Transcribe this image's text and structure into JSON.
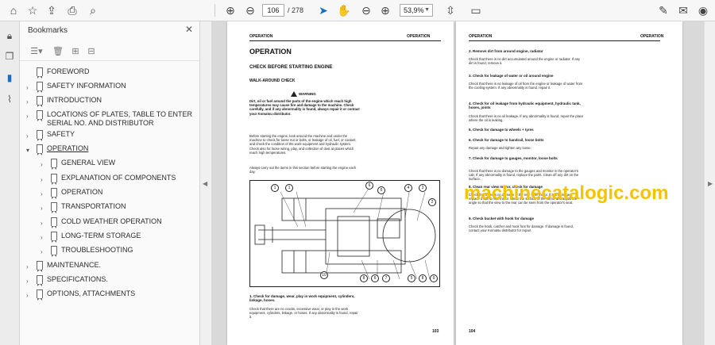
{
  "toolbar": {
    "page_current": "106",
    "page_total": "/ 278",
    "zoom": "53,9%",
    "icons": [
      "home-icon",
      "star-icon",
      "upload-icon",
      "print-icon",
      "zoom-search-icon",
      "prev-page-icon",
      "next-page-icon",
      "cursor-icon",
      "hand-icon",
      "zoom-out-icon",
      "zoom-in-icon",
      "fit-page-icon",
      "comment-icon",
      "pen-sign-icon",
      "mail-icon",
      "account-icon"
    ]
  },
  "bookmarks": {
    "title": "Bookmarks",
    "items": [
      {
        "label": "FOREWORD",
        "level": 0,
        "expandable": false
      },
      {
        "label": "SAFETY INFORMATION",
        "level": 0,
        "expandable": true
      },
      {
        "label": "INTRODUCTION",
        "level": 0,
        "expandable": true
      },
      {
        "label": "LOCATIONS OF PLATES, TABLE TO ENTER SERIAL NO. AND DISTRIBUTOR",
        "level": 0,
        "expandable": true
      },
      {
        "label": "SAFETY",
        "level": 0,
        "expandable": true
      },
      {
        "label": "OPERATION",
        "level": 0,
        "expandable": true,
        "expanded": true,
        "selected": true
      },
      {
        "label": "GENERAL VIEW",
        "level": 1,
        "expandable": true
      },
      {
        "label": "EXPLANATION OF COMPONENTS",
        "level": 1,
        "expandable": true
      },
      {
        "label": "OPERATION",
        "level": 1,
        "expandable": true
      },
      {
        "label": "TRANSPORTATION",
        "level": 1,
        "expandable": true
      },
      {
        "label": "COLD WEATHER OPERATION",
        "level": 1,
        "expandable": true
      },
      {
        "label": "LONG-TERM STORAGE",
        "level": 1,
        "expandable": true
      },
      {
        "label": "TROUBLESHOOTING",
        "level": 1,
        "expandable": true
      },
      {
        "label": "MAINTENANCE.",
        "level": 0,
        "expandable": true
      },
      {
        "label": "SPECIFICATIONS.",
        "level": 0,
        "expandable": true
      },
      {
        "label": "OPTIONS, ATTACHMENTS",
        "level": 0,
        "expandable": true
      }
    ]
  },
  "left_page": {
    "header_left": "OPERATION",
    "header_right": "OPERATION",
    "section": "OPERATION",
    "subsection": "CHECK BEFORE STARTING ENGINE",
    "subsub": "WALK-AROUND CHECK",
    "warning_label": "WARNING",
    "warning_text": "Dirt, oil or fuel around the parts of the engine which reach high temperatures may cause fire and damage to the machine. Check carefully, and if any abnormality is found, always repair it or contact your Komatsu distributor.",
    "body1": "Before starting the engine, look around the machine and under the machine to check for loose nut or bolts, or leakage of oil, fuel, or coolant, and check the condition of the work equipment and hydraulic system. Check also for loose wiring, play, and collection of dust at places which reach high temperatures.",
    "body2": "Always carry out the items in this section before starting the engine each day.",
    "callouts": [
      "1",
      "1",
      "6",
      "6",
      "4",
      "3",
      "2",
      "10",
      "8",
      "6",
      "7",
      "5",
      "8",
      "9"
    ],
    "item1_title": "1. Check for damage, wear, play in work equipment, cylinders, linkage, hoses.",
    "item1_text": "Check that there are no cracks, excessive wear, or play in the work equipment, cylinders, linkage, or hoses. If any abnormality is found, repair it.",
    "page_number": "103"
  },
  "right_page": {
    "header_left": "OPERATION",
    "header_right": "OPERATION",
    "items": [
      {
        "title": "2. Remove dirt from around engine, radiator",
        "text": "Check that there is no dirt accumulated around the engine or radiator. If any dirt is found, remove it."
      },
      {
        "title": "3. Check for leakage of water or oil around engine",
        "text": "Check that there is no leakage of oil from the engine or leakage of water from the cooling system. If any abnormality is found, repair it."
      },
      {
        "title": "4. Check for oil leakage from hydraulic equipment, hydraulic tank, hoses, joints",
        "text": "Check that there is no oil leakage. If any abnormality is found, repair the place where the oil is leaking."
      },
      {
        "title": "5. Check for damage to wheels + tyres",
        "text": ""
      },
      {
        "title": "6. Check for damage to handrail, loose bolts",
        "text": "Repair any damage and tighten any loose."
      },
      {
        "title": "7. Check for damage to gauges, monitor, loose bolts",
        "text": "Check that there is no damage to the gauges and monitor in the operator's cab. If any abnormality is found, replace the parts. Clean off any dirt on the surface."
      },
      {
        "title": "8. Clean rear view mirror, check for damage",
        "text": "Check that there is no damage to the rear view mirror. If it is damaged, replace it with a new mirror. Clean the surface of the mirror and adjust the angle so that the view to the rear can be seen from the operator's seat."
      },
      {
        "title": "9. Check bucket with hook for damage",
        "text": "Check the hook, catcher and hook foot for damage. If damage is found, contact your Komatsu distributor for repair."
      }
    ],
    "page_number": "104"
  },
  "watermark": "machinecatalogic.com"
}
